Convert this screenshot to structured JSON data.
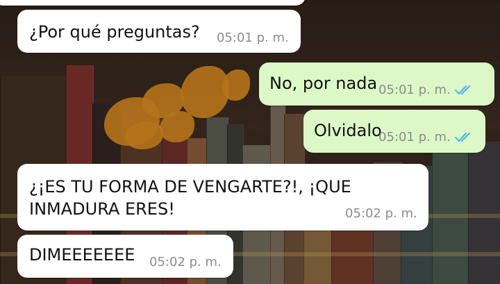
{
  "colors": {
    "incoming_bubble": "#ffffff",
    "outgoing_bubble": "#dcf8c6",
    "read_ticks": "#4fb6ec",
    "timestamp": "#8c8c8c"
  },
  "messages": [
    {
      "direction": "incoming",
      "text": "¿Por qué preguntas?",
      "time": "05:01 p. m."
    },
    {
      "direction": "outgoing",
      "text": "No, por nada",
      "time": "05:01 p. m.",
      "status_icon": "double-check-read-icon"
    },
    {
      "direction": "outgoing",
      "text": "Olvidalo",
      "time": "05:01 p. m.",
      "status_icon": "double-check-read-icon"
    },
    {
      "direction": "incoming",
      "lines": [
        "¿¡ES TU FORMA DE VENGARTE?!, ¡QUE",
        "INMADURA ERES!"
      ],
      "time": "05:02 p. m."
    },
    {
      "direction": "incoming",
      "text": "DIMEEEEEEE",
      "time": "05:02 p. m."
    }
  ]
}
